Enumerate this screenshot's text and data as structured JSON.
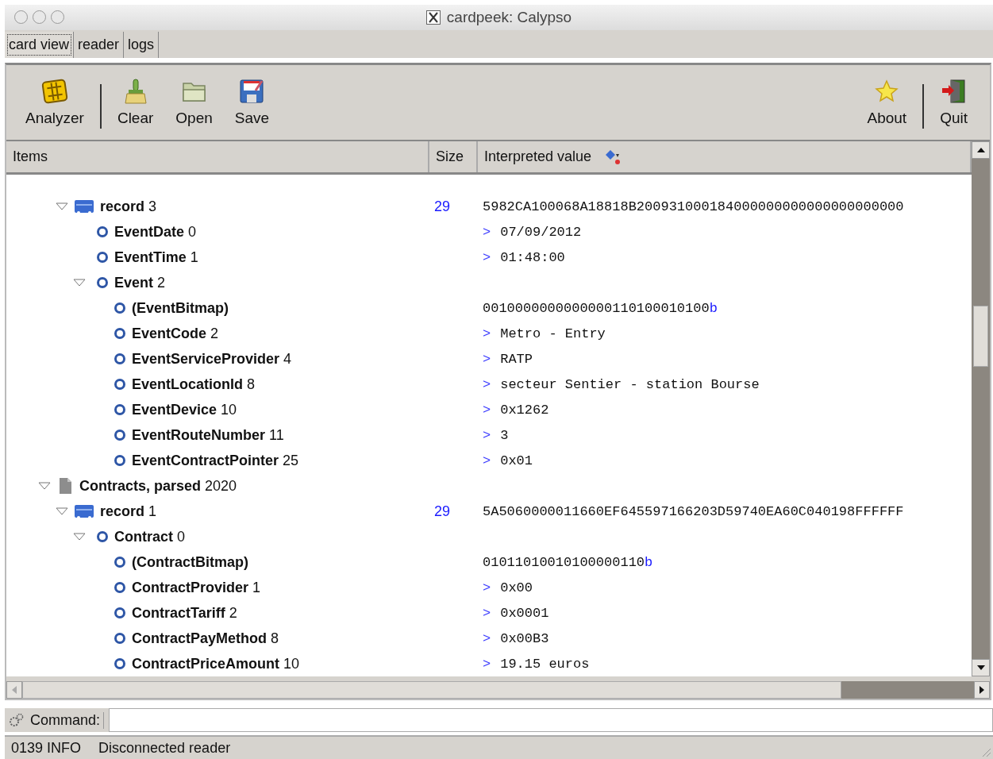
{
  "window": {
    "title": "cardpeek: Calypso"
  },
  "tabs": [
    {
      "label": "card view",
      "selected": true
    },
    {
      "label": "reader",
      "selected": false
    },
    {
      "label": "logs",
      "selected": false
    }
  ],
  "toolbar": {
    "left": [
      {
        "label": "Analyzer",
        "kind": "chip"
      },
      {
        "kind": "separator"
      },
      {
        "label": "Clear",
        "kind": "broom"
      },
      {
        "label": "Open",
        "kind": "folder"
      },
      {
        "label": "Save",
        "kind": "floppy"
      }
    ],
    "right": [
      {
        "label": "About",
        "kind": "star"
      },
      {
        "kind": "separator"
      },
      {
        "label": "Quit",
        "kind": "door"
      }
    ]
  },
  "table": {
    "columns": [
      "Items",
      "Size",
      "Interpreted value"
    ],
    "items": [
      {
        "children": [
          {
            "name": "record",
            "index": "3",
            "kind": "record",
            "expanded": true,
            "size": "29",
            "value": "5982CA100068A18818B200931000184000000000000000000000",
            "children": [
              {
                "name": "EventDate",
                "index": "0",
                "kind": "field",
                "marker": ">",
                "value": "07/09/2012"
              },
              {
                "name": "EventTime",
                "index": "1",
                "kind": "field",
                "marker": ">",
                "value": "01:48:00"
              },
              {
                "name": "Event",
                "index": "2",
                "kind": "field",
                "expanded": true,
                "children": [
                  {
                    "name": "(EventBitmap)",
                    "kind": "field",
                    "value": "0010000000000000110100010100",
                    "suffix": "b"
                  },
                  {
                    "name": "EventCode",
                    "index": "2",
                    "kind": "field",
                    "marker": ">",
                    "value": "Metro - Entry"
                  },
                  {
                    "name": "EventServiceProvider",
                    "index": "4",
                    "kind": "field",
                    "marker": ">",
                    "value": "RATP"
                  },
                  {
                    "name": "EventLocationId",
                    "index": "8",
                    "kind": "field",
                    "marker": ">",
                    "value": "secteur Sentier - station Bourse"
                  },
                  {
                    "name": "EventDevice",
                    "index": "10",
                    "kind": "field",
                    "marker": ">",
                    "value": "0x1262"
                  },
                  {
                    "name": "EventRouteNumber",
                    "index": "11",
                    "kind": "field",
                    "marker": ">",
                    "value": "3"
                  },
                  {
                    "name": "EventContractPointer",
                    "index": "25",
                    "kind": "field",
                    "marker": ">",
                    "value": "0x01"
                  }
                ]
              }
            ]
          }
        ]
      },
      {
        "name": "Contracts, parsed",
        "index": "2020",
        "kind": "file",
        "expanded": true,
        "children": [
          {
            "name": "record",
            "index": "1",
            "kind": "record",
            "expanded": true,
            "size": "29",
            "value": "5A5060000011660EF645597166203D59740EA60C040198FFFFFF",
            "children": [
              {
                "name": "Contract",
                "index": "0",
                "kind": "field",
                "expanded": true,
                "children": [
                  {
                    "name": "(ContractBitmap)",
                    "kind": "field",
                    "value": "01011010010100000110",
                    "suffix": "b"
                  },
                  {
                    "name": "ContractProvider",
                    "index": "1",
                    "kind": "field",
                    "marker": ">",
                    "value": "0x00"
                  },
                  {
                    "name": "ContractTariff",
                    "index": "2",
                    "kind": "field",
                    "marker": ">",
                    "value": "0x0001"
                  },
                  {
                    "name": "ContractPayMethod",
                    "index": "8",
                    "kind": "field",
                    "marker": ">",
                    "value": "0x00B3"
                  },
                  {
                    "name": "ContractPriceAmount",
                    "index": "10",
                    "kind": "field",
                    "marker": ">",
                    "value": "19.15 euros"
                  }
                ]
              }
            ]
          }
        ]
      }
    ]
  },
  "command": {
    "label": "Command:"
  },
  "status_bar": {
    "code": "0139 INFO",
    "message": "Disconnected reader"
  }
}
